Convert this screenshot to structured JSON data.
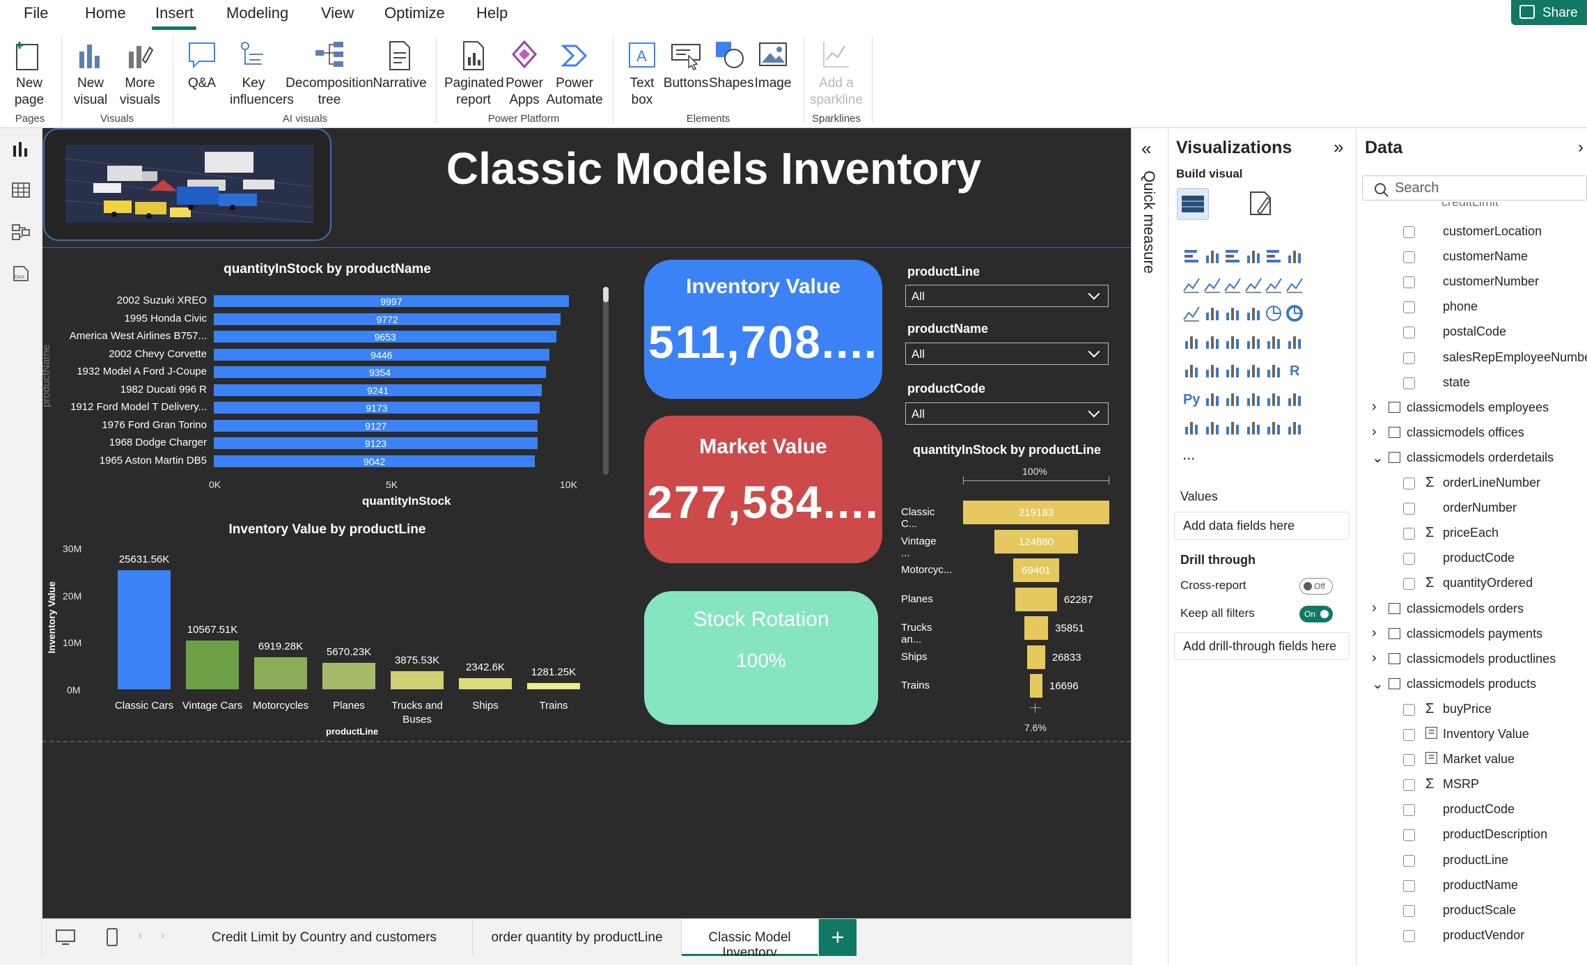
{
  "menu": [
    "File",
    "Home",
    "Insert",
    "Modeling",
    "View",
    "Optimize",
    "Help"
  ],
  "share": "Share",
  "ribbon": {
    "new_page": "New page",
    "new_visual": "New visual",
    "more_visuals": "More visuals",
    "qa": "Q&A",
    "key_influencers": "Key influencers",
    "decomposition_tree": "Decomposition tree",
    "narrative": "Narrative",
    "paginated_report": "Paginated report",
    "power_apps": "Power Apps",
    "power_automate": "Power Automate",
    "text_box": "Text box",
    "buttons": "Buttons",
    "shapes": "Shapes",
    "image": "Image",
    "add_sparkline": "Add a sparkline",
    "groups": {
      "pages": "Pages",
      "visuals": "Visuals",
      "ai_visuals": "AI visuals",
      "power_platform": "Power Platform",
      "elements": "Elements",
      "sparklines": "Sparklines"
    }
  },
  "report": {
    "title": "Classic Models Inventory",
    "hbar": {
      "title": "quantityInStock by productName",
      "ylabel": "productName",
      "xlabel": "quantityInStock",
      "ticks": [
        "0K",
        "5K",
        "10K"
      ]
    },
    "vbar": {
      "title": "Inventory Value by productLine",
      "ylabel": "Inventory Value",
      "xlabel": "productLine",
      "ticks": [
        "30M",
        "20M",
        "10M",
        "0M"
      ]
    },
    "cards": {
      "inventory_title": "Inventory Value",
      "inventory_value": "511,708....",
      "market_title": "Market Value",
      "market_value": "277,584....",
      "rotation_title": "Stock Rotation",
      "rotation_value": "100%"
    },
    "slicers": {
      "productLine_label": "productLine",
      "productLine_value": "All",
      "productName_label": "productName",
      "productName_value": "All",
      "productCode_label": "productCode",
      "productCode_value": "All"
    },
    "funnel": {
      "title": "quantityInStock by productLine",
      "top_pct": "100%",
      "bottom_pct": "7.6%"
    },
    "colors": {
      "hbar": "#3b82f6",
      "inventory_card": "#3b82f6",
      "market_card": "#cc4a4a",
      "rotation_card": "#86e5c1",
      "funnel": "#e5c85e"
    }
  },
  "chart_data": [
    {
      "type": "bar",
      "orientation": "horizontal",
      "title": "quantityInStock by productName",
      "xlabel": "quantityInStock",
      "ylabel": "productName",
      "xlim": [
        0,
        10000
      ],
      "categories": [
        "2002 Suzuki XREO",
        "1995 Honda Civic",
        "America West Airlines B757...",
        "2002 Chevy Corvette",
        "1932 Model A Ford J-Coupe",
        "1982 Ducati 996 R",
        "1912 Ford Model T Delivery...",
        "1976 Ford Gran Torino",
        "1968 Dodge Charger",
        "1965 Aston Martin DB5"
      ],
      "values": [
        9997,
        9772,
        9653,
        9446,
        9354,
        9241,
        9173,
        9127,
        9123,
        9042
      ]
    },
    {
      "type": "bar",
      "title": "Inventory Value by productLine",
      "xlabel": "productLine",
      "ylabel": "Inventory Value",
      "ylim": [
        0,
        30000000
      ],
      "categories": [
        "Classic Cars",
        "Vintage Cars",
        "Motorcycles",
        "Planes",
        "Trucks and Buses",
        "Ships",
        "Trains"
      ],
      "values": [
        25631.56,
        10567.51,
        6919.28,
        5670.23,
        3875.53,
        2342.6,
        1281.25
      ],
      "labels": [
        "25631.56K",
        "10567.51K",
        "6919.28K",
        "5670.23K",
        "3875.53K",
        "2342.6K",
        "1281.25K"
      ],
      "colors": [
        "#3b82f6",
        "#6ea147",
        "#8cad57",
        "#a5bb6a",
        "#cfd173",
        "#dedc78",
        "#f0ec8a"
      ]
    },
    {
      "type": "funnel",
      "title": "quantityInStock by productLine",
      "categories": [
        "Classic C...",
        "Vintage ...",
        "Motorcyc...",
        "Planes",
        "Trucks an...",
        "Ships",
        "Trains"
      ],
      "values": [
        219183,
        124880,
        69401,
        62287,
        35851,
        26833,
        16696
      ]
    }
  ],
  "tabs": {
    "tab1": "Credit Limit by Country and customers",
    "tab2": "order quantity by productLine",
    "tab3": "Classic Model Inventory",
    "add": "+"
  },
  "quick_measure": "Quick measure",
  "viz_pane": {
    "title": "Visualizations",
    "build": "Build visual",
    "values": "Values",
    "add_data": "Add data fields here",
    "drill": "Drill through",
    "cross_report": "Cross-report",
    "cross_report_state": "Off",
    "keep_filters": "Keep all filters",
    "keep_filters_state": "On",
    "add_drill": "Add drill-through fields here",
    "more": "...",
    "py": "Py",
    "r": "R"
  },
  "data_pane": {
    "title": "Data",
    "search_placeholder": "Search",
    "partial_top": "creditLimit",
    "fields_customers": [
      "customerLocation",
      "customerName",
      "customerNumber",
      "phone",
      "postalCode",
      "salesRepEmployeeNumber",
      "state"
    ],
    "tables_a": [
      "classicmodels employees",
      "classicmodels offices",
      "classicmodels orderdetails"
    ],
    "fields_orderdetails": [
      "orderLineNumber",
      "orderNumber",
      "priceEach",
      "productCode",
      "quantityOrdered"
    ],
    "tables_b": [
      "classicmodels orders",
      "classicmodels payments",
      "classicmodels productlines",
      "classicmodels products"
    ],
    "fields_products": [
      "buyPrice",
      "Inventory Value",
      "Market value",
      "MSRP",
      "productCode",
      "productDescription",
      "productLine",
      "productName",
      "productScale",
      "productVendor"
    ]
  }
}
